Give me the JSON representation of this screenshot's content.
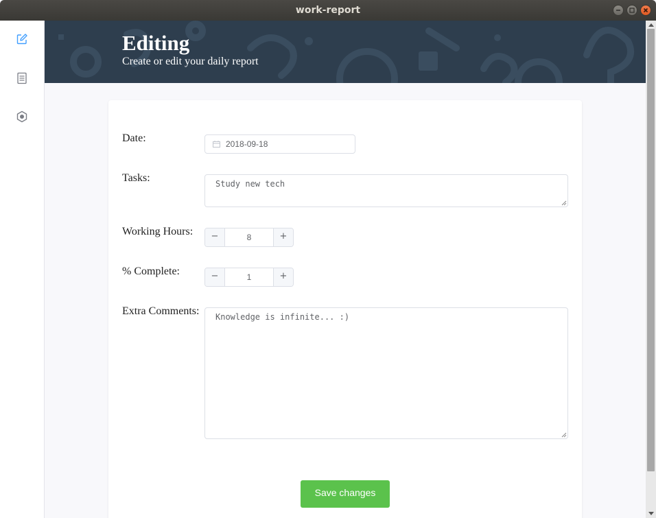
{
  "window": {
    "title": "work-report"
  },
  "header": {
    "title": "Editing",
    "subtitle": "Create or edit your daily report"
  },
  "sidebar": {
    "items": [
      {
        "icon": "edit-icon",
        "active": true
      },
      {
        "icon": "document-list-icon",
        "active": false
      },
      {
        "icon": "settings-icon",
        "active": false
      }
    ]
  },
  "form": {
    "date": {
      "label": "Date:",
      "value": "2018-09-18"
    },
    "tasks": {
      "label": "Tasks:",
      "value": "Study new tech"
    },
    "working_hours": {
      "label": "Working Hours:",
      "value": "8",
      "decrement": "−",
      "increment": "+"
    },
    "complete": {
      "label": "% Complete:",
      "value": "1",
      "decrement": "−",
      "increment": "+"
    },
    "comments": {
      "label": "Extra Comments:",
      "value": "Knowledge is infinite... :)"
    },
    "save_label": "Save changes"
  },
  "colors": {
    "accent": "#409eff",
    "banner": "#2e3e4e",
    "save_button": "#5bc24c",
    "close_button": "#e25a22"
  }
}
